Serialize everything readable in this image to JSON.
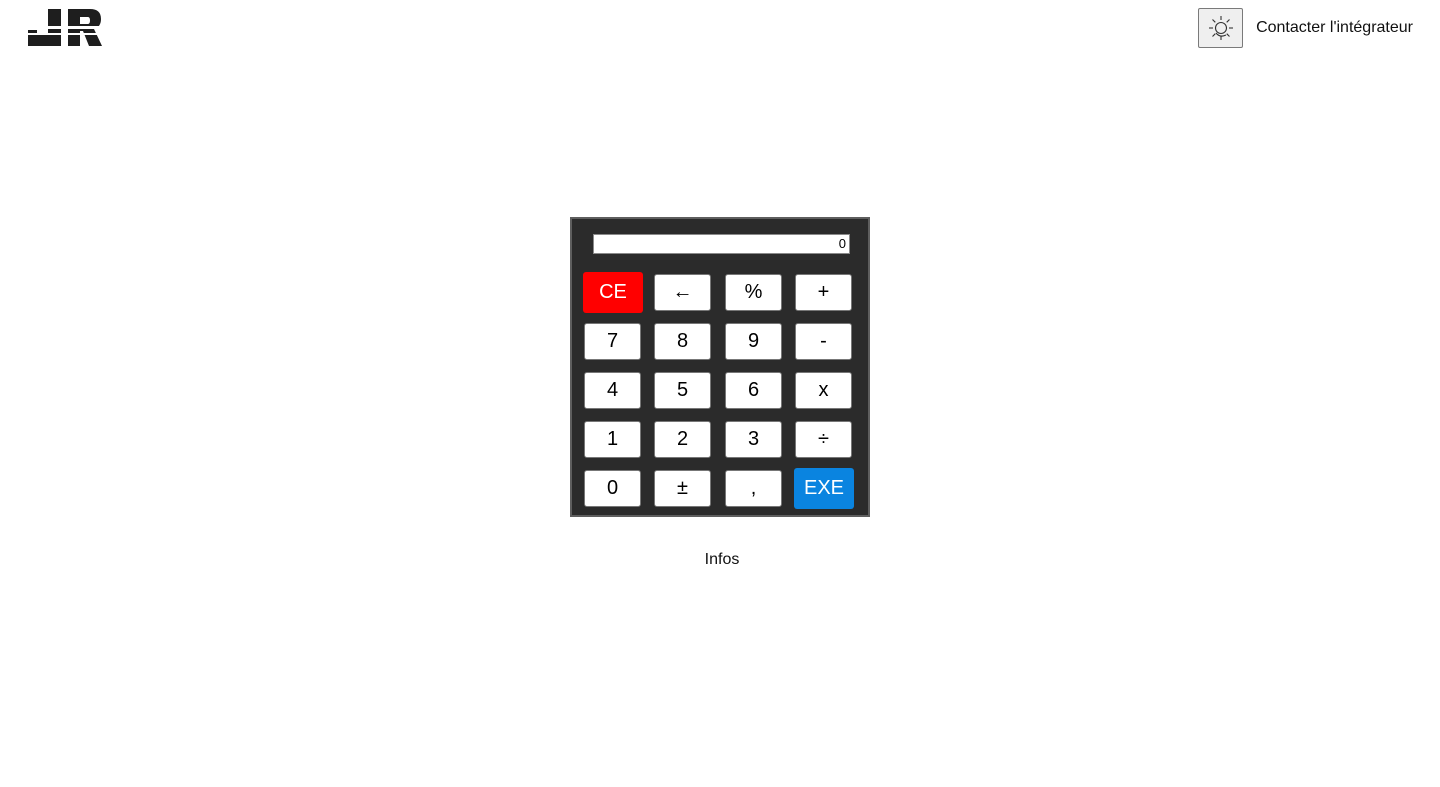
{
  "header": {
    "logo_alt": "JR",
    "theme_toggle_icon": "sun-moon-icon",
    "contact_label": "Contacter l'intégrateur"
  },
  "calculator": {
    "display_value": "0",
    "keys": [
      {
        "label": "CE",
        "kind": "clear"
      },
      {
        "label": "←",
        "kind": "backspace"
      },
      {
        "label": "%",
        "kind": "operator"
      },
      {
        "label": "+",
        "kind": "operator"
      },
      {
        "label": "7",
        "kind": "digit"
      },
      {
        "label": "8",
        "kind": "digit"
      },
      {
        "label": "9",
        "kind": "digit"
      },
      {
        "label": "-",
        "kind": "operator"
      },
      {
        "label": "4",
        "kind": "digit"
      },
      {
        "label": "5",
        "kind": "digit"
      },
      {
        "label": "6",
        "kind": "digit"
      },
      {
        "label": "x",
        "kind": "operator"
      },
      {
        "label": "1",
        "kind": "digit"
      },
      {
        "label": "2",
        "kind": "digit"
      },
      {
        "label": "3",
        "kind": "digit"
      },
      {
        "label": "÷",
        "kind": "operator"
      },
      {
        "label": "0",
        "kind": "digit"
      },
      {
        "label": "±",
        "kind": "sign"
      },
      {
        "label": ",",
        "kind": "decimal"
      },
      {
        "label": "EXE",
        "kind": "execute"
      }
    ],
    "colors": {
      "body": "#2b2b2b",
      "clear": "#ff0000",
      "execute": "#0a84e0"
    }
  },
  "footer": {
    "infos_label": "Infos"
  }
}
